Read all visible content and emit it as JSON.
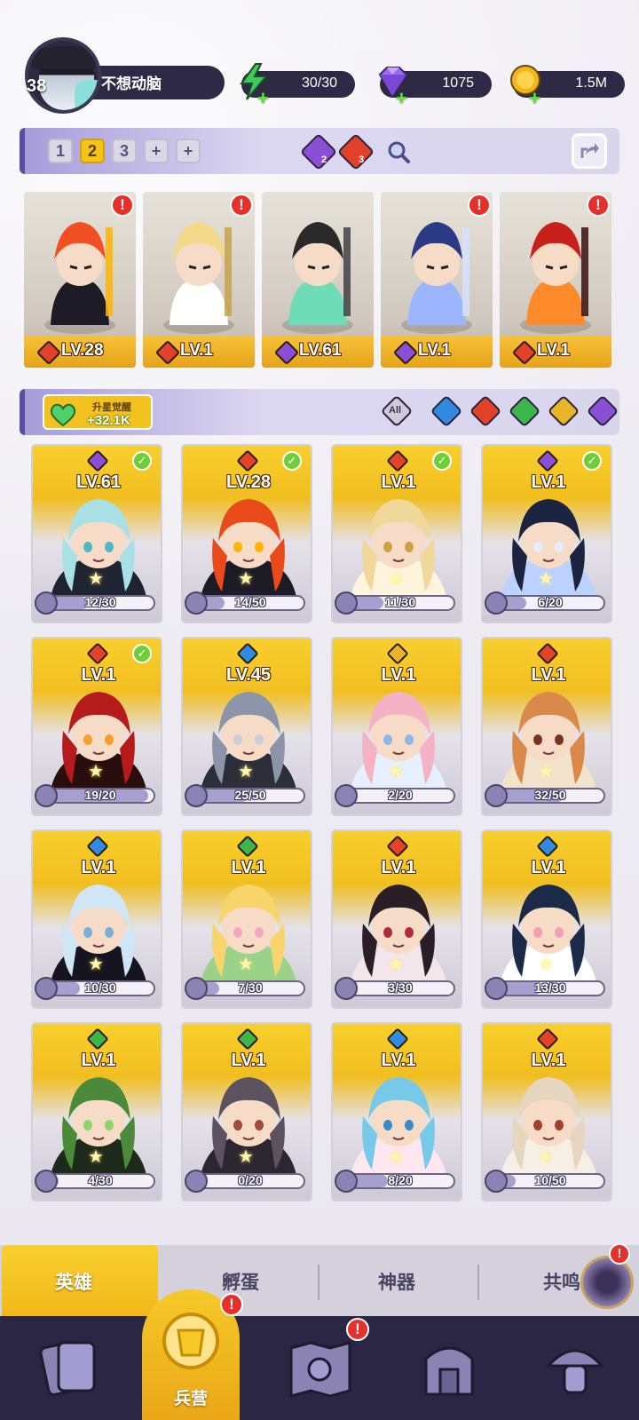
{
  "player": {
    "level": "38",
    "name": "不想动脑"
  },
  "resources": [
    {
      "name": "energy",
      "icon": "lightning-icon",
      "value": "30/30",
      "color": "#48d16b"
    },
    {
      "name": "gems",
      "icon": "gem-icon",
      "value": "1075",
      "color": "#9b6cf0"
    },
    {
      "name": "gold",
      "icon": "coin-icon",
      "value": "1.5M",
      "color": "#f2b51c"
    }
  ],
  "team": {
    "slots": [
      "1",
      "2",
      "3",
      "+",
      "+"
    ],
    "active_slot": "2",
    "counts": [
      {
        "element": "moon",
        "count": "2"
      },
      {
        "element": "fire",
        "count": "3"
      }
    ],
    "heroes": [
      {
        "element": "fire",
        "level": "LV.28",
        "alert": "!"
      },
      {
        "element": "fire",
        "level": "LV.1",
        "alert": "!"
      },
      {
        "element": "moon",
        "level": "LV.61",
        "alert": ""
      },
      {
        "element": "moon",
        "level": "LV.1",
        "alert": "!"
      },
      {
        "element": "fire",
        "level": "LV.1",
        "alert": "!"
      }
    ]
  },
  "awaken": {
    "title": "升星觉醒",
    "value": "+32.1K"
  },
  "filters": {
    "all_label": "All",
    "elements": [
      "water",
      "fire",
      "nature",
      "light",
      "moon"
    ]
  },
  "elements_colors": {
    "fire": "#e2412a",
    "water": "#2f8ae0",
    "nature": "#3cb54a",
    "light": "#e8b524",
    "moon": "#8a4fd6"
  },
  "heroes": [
    {
      "element": "moon",
      "level": "LV.61",
      "progress": "12/30",
      "checked": true
    },
    {
      "element": "fire",
      "level": "LV.28",
      "progress": "14/50",
      "checked": true
    },
    {
      "element": "fire",
      "level": "LV.1",
      "progress": "11/30",
      "checked": true
    },
    {
      "element": "moon",
      "level": "LV.1",
      "progress": "6/20",
      "checked": true
    },
    {
      "element": "fire",
      "level": "LV.1",
      "progress": "19/20",
      "checked": true
    },
    {
      "element": "water",
      "level": "LV.45",
      "progress": "25/50",
      "checked": false
    },
    {
      "element": "light",
      "level": "LV.1",
      "progress": "2/20",
      "checked": false
    },
    {
      "element": "fire",
      "level": "LV.1",
      "progress": "32/50",
      "checked": false
    },
    {
      "element": "water",
      "level": "LV.1",
      "progress": "10/30",
      "checked": false
    },
    {
      "element": "nature",
      "level": "LV.1",
      "progress": "7/30",
      "checked": false
    },
    {
      "element": "fire",
      "level": "LV.1",
      "progress": "3/30",
      "checked": false
    },
    {
      "element": "water",
      "level": "LV.1",
      "progress": "13/30",
      "checked": false
    },
    {
      "element": "nature",
      "level": "LV.1",
      "progress": "4/30",
      "checked": false
    },
    {
      "element": "nature",
      "level": "LV.1",
      "progress": "0/20",
      "checked": false
    },
    {
      "element": "water",
      "level": "LV.1",
      "progress": "8/20",
      "checked": false
    },
    {
      "element": "fire",
      "level": "LV.1",
      "progress": "10/50",
      "checked": false
    }
  ],
  "subtabs": [
    "英雄",
    "孵蛋",
    "神器",
    "共鸣"
  ],
  "subtab_alert": "!",
  "nav": {
    "items": [
      "cards-icon",
      "barracks-icon",
      "map-icon",
      "temple-icon",
      "mushroom-icon"
    ],
    "active_label": "兵营",
    "alerts": [
      "",
      "!",
      "!",
      "",
      ""
    ]
  }
}
